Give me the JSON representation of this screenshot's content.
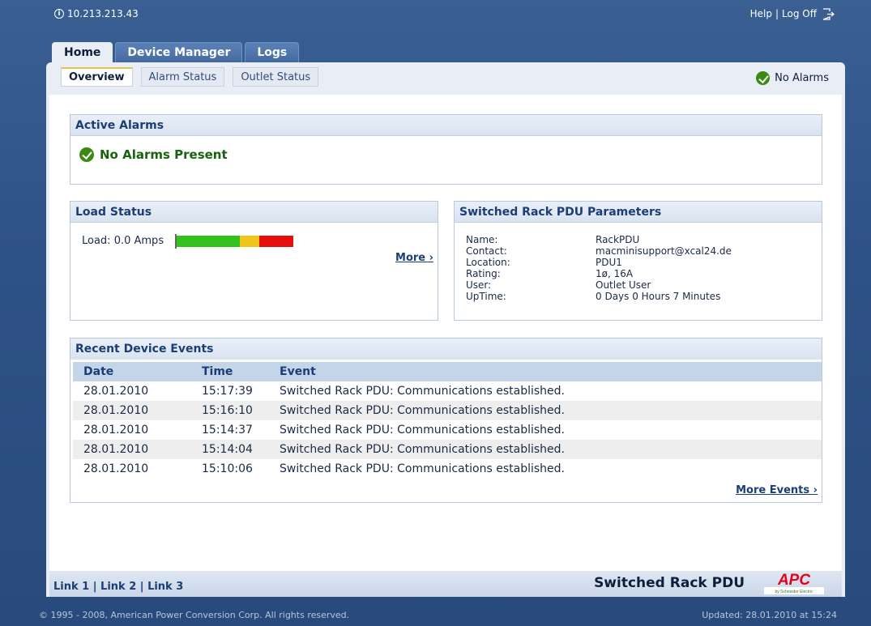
{
  "topbar": {
    "ip": "10.213.213.43",
    "help": "Help",
    "separator": "|",
    "logoff": "Log Off"
  },
  "main_tabs": [
    {
      "label": "Home",
      "active": true
    },
    {
      "label": "Device Manager",
      "active": false
    },
    {
      "label": "Logs",
      "active": false
    }
  ],
  "sub_tabs": [
    {
      "label": "Overview",
      "active": true
    },
    {
      "label": "Alarm Status",
      "active": false
    },
    {
      "label": "Outlet Status",
      "active": false
    }
  ],
  "alarm_summary": "No Alarms",
  "active_alarms": {
    "title": "Active Alarms",
    "message": "No Alarms Present"
  },
  "load_status": {
    "title": "Load Status",
    "label": "Load: 0.0 Amps",
    "load_fraction": 0.0,
    "more": "More ›",
    "colors": {
      "green": "#33c11d",
      "yellow": "#f0c419",
      "red": "#e60d0d"
    }
  },
  "parameters": {
    "title": "Switched Rack PDU Parameters",
    "rows": [
      {
        "label": "Name:",
        "value": "RackPDU"
      },
      {
        "label": "Contact:",
        "value": "macminisupport@xcal24.de"
      },
      {
        "label": "Location:",
        "value": "PDU1"
      },
      {
        "label": "Rating:",
        "value": "1ø, 16A"
      },
      {
        "label": "User:",
        "value": "Outlet User"
      },
      {
        "label": "UpTime:",
        "value": "0 Days 0 Hours 7 Minutes"
      }
    ]
  },
  "events": {
    "title": "Recent Device Events",
    "columns": [
      "Date",
      "Time",
      "Event"
    ],
    "rows": [
      [
        "28.01.2010",
        "15:17:39",
        "Switched Rack PDU: Communications established."
      ],
      [
        "28.01.2010",
        "15:16:10",
        "Switched Rack PDU: Communications established."
      ],
      [
        "28.01.2010",
        "15:14:37",
        "Switched Rack PDU: Communications established."
      ],
      [
        "28.01.2010",
        "15:14:04",
        "Switched Rack PDU: Communications established."
      ],
      [
        "28.01.2010",
        "15:10:06",
        "Switched Rack PDU: Communications established."
      ]
    ],
    "more": "More Events ›"
  },
  "footer": {
    "links": [
      "Link 1",
      "Link 2",
      "Link 3"
    ],
    "product": "Switched Rack PDU",
    "logo": {
      "text": "APC",
      "subtext": "by Schneider Electric",
      "color": "#e2001a"
    },
    "copyright": "© 1995 - 2008, American Power Conversion Corp. All rights reserved.",
    "updated": "Updated: 28.01.2010 at 15:24"
  },
  "icons": {
    "info": "info-icon",
    "logoff": "logoff-icon",
    "status": "check-icon"
  }
}
